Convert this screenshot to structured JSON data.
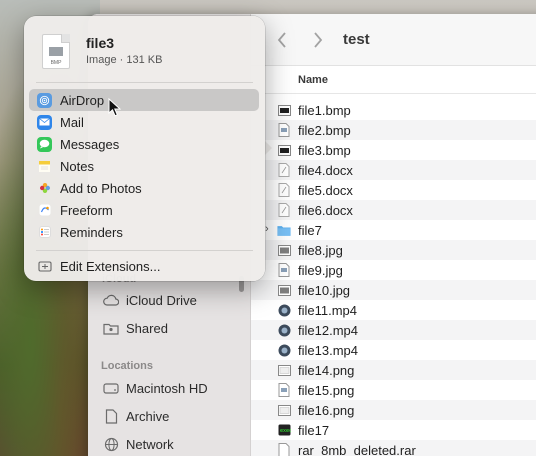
{
  "finder": {
    "title": "test",
    "column_name": "Name",
    "sidebar": {
      "peek_heading": "iCloud",
      "icloud_items": [
        {
          "label": "iCloud Drive",
          "icon": "cloud-icon"
        },
        {
          "label": "Shared",
          "icon": "shared-folder-icon"
        }
      ],
      "locations_heading": "Locations",
      "location_items": [
        {
          "label": "Macintosh HD",
          "icon": "drive-icon"
        },
        {
          "label": "Archive",
          "icon": "document-icon"
        },
        {
          "label": "Network",
          "icon": "globe-icon"
        }
      ]
    },
    "files": [
      {
        "name": "file1.bmp",
        "kind": "bmp"
      },
      {
        "name": "file2.bmp",
        "kind": "bmp2"
      },
      {
        "name": "file3.bmp",
        "kind": "bmp"
      },
      {
        "name": "file4.docx",
        "kind": "docx"
      },
      {
        "name": "file5.docx",
        "kind": "docx"
      },
      {
        "name": "file6.docx",
        "kind": "docx"
      },
      {
        "name": "file7",
        "kind": "folder"
      },
      {
        "name": "file8.jpg",
        "kind": "jpg"
      },
      {
        "name": "file9.jpg",
        "kind": "jpg2"
      },
      {
        "name": "file10.jpg",
        "kind": "jpg"
      },
      {
        "name": "file11.mp4",
        "kind": "mp4"
      },
      {
        "name": "file12.mp4",
        "kind": "mp4"
      },
      {
        "name": "file13.mp4",
        "kind": "mp4"
      },
      {
        "name": "file14.png",
        "kind": "png"
      },
      {
        "name": "file15.png",
        "kind": "jpg2"
      },
      {
        "name": "file16.png",
        "kind": "png"
      },
      {
        "name": "file17",
        "kind": "exec"
      },
      {
        "name": "rar_8mb_deleted.rar",
        "kind": "rar"
      }
    ]
  },
  "share_popover": {
    "file_name": "file3",
    "file_info": "Image · 131 KB",
    "file_icon_ext": "BMP",
    "items": [
      {
        "label": "AirDrop",
        "icon": "airdrop-icon",
        "color": "#5a9be0",
        "highlight": true
      },
      {
        "label": "Mail",
        "icon": "mail-icon",
        "color": "#2f86ea"
      },
      {
        "label": "Messages",
        "icon": "messages-icon",
        "color": "#34c759"
      },
      {
        "label": "Notes",
        "icon": "notes-icon",
        "color": "#f5cd3b"
      },
      {
        "label": "Add to Photos",
        "icon": "photos-icon",
        "color": "#e8594a"
      },
      {
        "label": "Freeform",
        "icon": "freeform-icon",
        "color": "#3b82f6"
      },
      {
        "label": "Reminders",
        "icon": "reminders-icon",
        "color": "#ffffff"
      }
    ],
    "edit_extensions": "Edit Extensions..."
  }
}
